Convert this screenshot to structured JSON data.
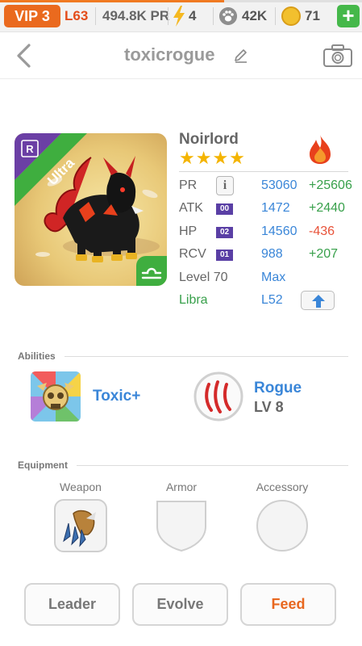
{
  "status_bar": {
    "vip": "VIP 3",
    "level": "L63",
    "power": "494.8K PR",
    "energy": "4",
    "paws": "42K",
    "coins": "71",
    "add_button": "+",
    "progress_fraction": 0.62
  },
  "header": {
    "title": "toxicrogue"
  },
  "pet": {
    "rarity": "Ultra",
    "badge": "R",
    "name": "Noirlord",
    "stars": "★★★★",
    "element_icon": "fire-icon",
    "zodiac_icon": "libra-icon",
    "stats": {
      "pr": {
        "label": "PR",
        "info": "i",
        "value": "53060",
        "bonus": "+25606"
      },
      "atk": {
        "label": "ATK",
        "tag": "00",
        "value": "1472",
        "bonus": "+2440"
      },
      "hp": {
        "label": "HP",
        "tag": "02",
        "value": "14560",
        "bonus": "-436"
      },
      "rcv": {
        "label": "RCV",
        "tag": "01",
        "value": "988",
        "bonus": "+207"
      },
      "level": {
        "label": "Level 70",
        "value": "Max"
      },
      "sign": {
        "label": "Libra",
        "value": "L52"
      }
    }
  },
  "abilities": {
    "heading": "Abilities",
    "items": [
      {
        "name": "Toxic+",
        "icon": "toxic-skull-icon"
      },
      {
        "name": "Rogue",
        "level": "LV 8",
        "icon": "claw-marks-icon"
      }
    ]
  },
  "equipment": {
    "heading": "Equipment",
    "slots": [
      {
        "label": "Weapon",
        "icon": "claw-weapon-icon"
      },
      {
        "label": "Armor",
        "icon": "shield-slot-icon"
      },
      {
        "label": "Accessory",
        "icon": "circle-slot-icon"
      }
    ]
  },
  "actions": {
    "leader": "Leader",
    "evolve": "Evolve",
    "feed": "Feed"
  },
  "colors": {
    "accent_orange": "#ea6a1e",
    "link_blue": "#3a86d8",
    "positive_green": "#38a04b",
    "negative_red": "#e8533a",
    "libra_green": "#38a04b",
    "tag_purple": "#5a3fa5"
  }
}
